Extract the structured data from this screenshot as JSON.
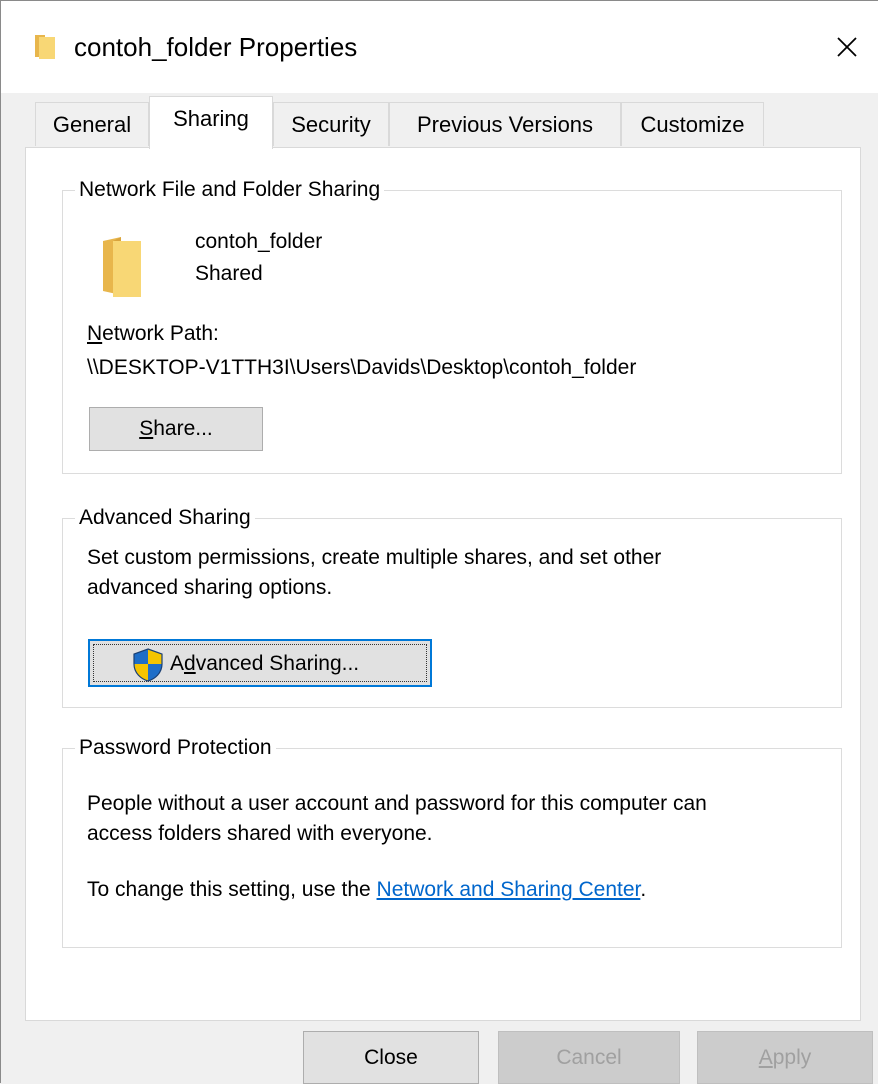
{
  "window": {
    "title": "contoh_folder Properties"
  },
  "tabs": [
    {
      "label": "General"
    },
    {
      "label": "Sharing"
    },
    {
      "label": "Security"
    },
    {
      "label": "Previous Versions"
    },
    {
      "label": "Customize"
    }
  ],
  "active_tab": "Sharing",
  "network_sharing": {
    "group_title": "Network File and Folder Sharing",
    "folder_name": "contoh_folder",
    "status": "Shared",
    "path_label_accel": "N",
    "path_label_rest": "etwork Path:",
    "path": "\\\\DESKTOP-V1TTH3I\\Users\\Davids\\Desktop\\contoh_folder",
    "share_button_accel": "S",
    "share_button_rest": "hare..."
  },
  "advanced_sharing": {
    "group_title": "Advanced Sharing",
    "description_line1": "Set custom permissions, create multiple shares, and set other",
    "description_line2": "advanced sharing options.",
    "button_pre": "A",
    "button_accel": "d",
    "button_rest": "vanced Sharing..."
  },
  "password_protection": {
    "group_title": "Password Protection",
    "line1": "People without a user account and password for this computer can",
    "line2": "access folders shared with everyone.",
    "line3_prefix": "To change this setting, use the ",
    "link_text": "Network and Sharing Center",
    "line3_suffix": "."
  },
  "footer": {
    "close_label": "Close",
    "cancel_label": "Cancel",
    "apply_accel": "A",
    "apply_rest": "pply"
  },
  "colors": {
    "accent": "#0078d7",
    "link": "#0066cc",
    "folder_yellow": "#f8d775",
    "shield_blue": "#1e6ec8",
    "shield_yellow": "#f5c400"
  }
}
